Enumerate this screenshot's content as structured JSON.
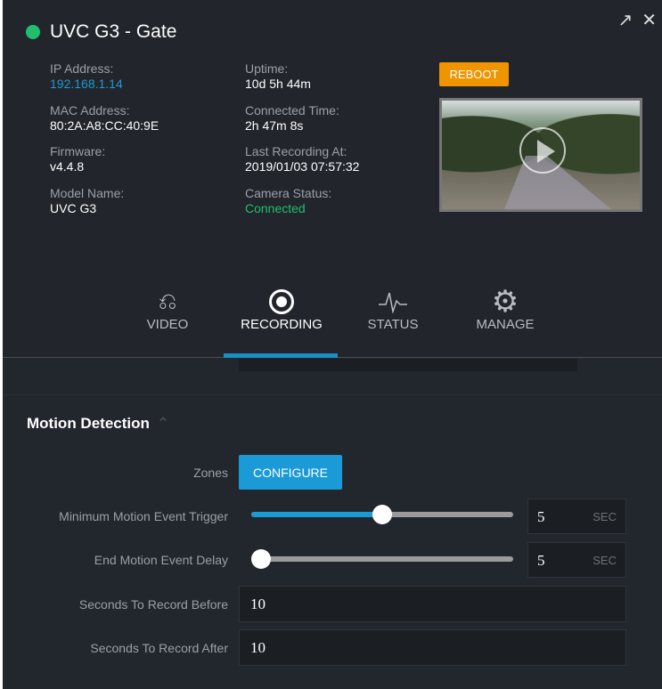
{
  "header": {
    "title": "UVC G3 - Gate",
    "status_color": "#1fbf6e",
    "popout_icon": "arrow-up-right",
    "close_icon": "x"
  },
  "info": {
    "ip_label": "IP Address:",
    "ip": "192.168.1.14",
    "mac_label": "MAC Address:",
    "mac": "80:2A:A8:CC:40:9E",
    "firmware_label": "Firmware:",
    "firmware": "v4.4.8",
    "model_label": "Model Name:",
    "model": "UVC G3",
    "uptime_label": "Uptime:",
    "uptime": "10d 5h 44m",
    "connected_label": "Connected Time:",
    "connected": "2h 47m 8s",
    "lastrec_label": "Last Recording At:",
    "lastrec": "2019/01/03 07:57:32",
    "status_label": "Camera Status:",
    "status": "Connected"
  },
  "reboot_label": "REBOOT",
  "tabs": [
    {
      "label": "VIDEO",
      "icon": "camera"
    },
    {
      "label": "RECORDING",
      "icon": "record",
      "active": true
    },
    {
      "label": "STATUS",
      "icon": "pulse"
    },
    {
      "label": "MANAGE",
      "icon": "gear"
    }
  ],
  "motion": {
    "title": "Motion Detection",
    "zones_label": "Zones",
    "configure_label": "CONFIGURE",
    "min_trigger_label": "Minimum Motion Event Trigger",
    "min_trigger_value": "5",
    "min_trigger_fraction": 0.5,
    "end_delay_label": "End Motion Event Delay",
    "end_delay_value": "5",
    "end_delay_fraction": 0,
    "unit": "SEC",
    "before_label": "Seconds To Record Before",
    "before_value": "10",
    "after_label": "Seconds To Record After",
    "after_value": "10"
  }
}
